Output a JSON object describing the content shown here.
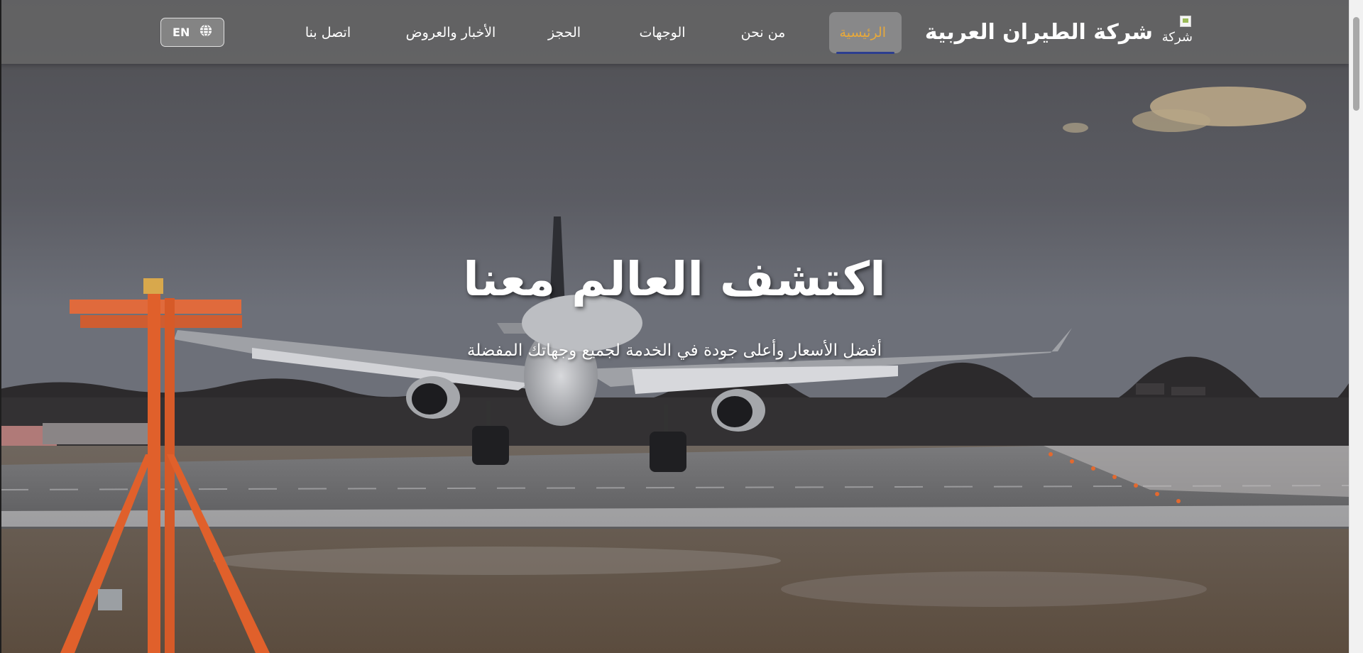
{
  "brand": {
    "name": "شركة الطيران العربية",
    "logo_alt": "شركة"
  },
  "nav": {
    "items": [
      {
        "label": "الرئيسية",
        "active": true
      },
      {
        "label": "من نحن",
        "active": false
      },
      {
        "label": "الوجهات",
        "active": false
      },
      {
        "label": "الحجز",
        "active": false
      },
      {
        "label": "الأخبار والعروض",
        "active": false
      },
      {
        "label": "اتصل بنا",
        "active": false
      }
    ],
    "lang_label": "EN"
  },
  "hero": {
    "title": "اكتشف العالم معنا",
    "subtitle": "أفضل الأسعار وأعلى جودة في الخدمة لجميع وجهاتك المفضلة"
  },
  "colors": {
    "active_nav_text": "#e8a93a",
    "active_nav_underline": "#2c3e8f",
    "navbar_bg": "rgba(105,105,105,0.72)",
    "text": "#ffffff"
  },
  "icons": {
    "language": "globe-icon"
  }
}
